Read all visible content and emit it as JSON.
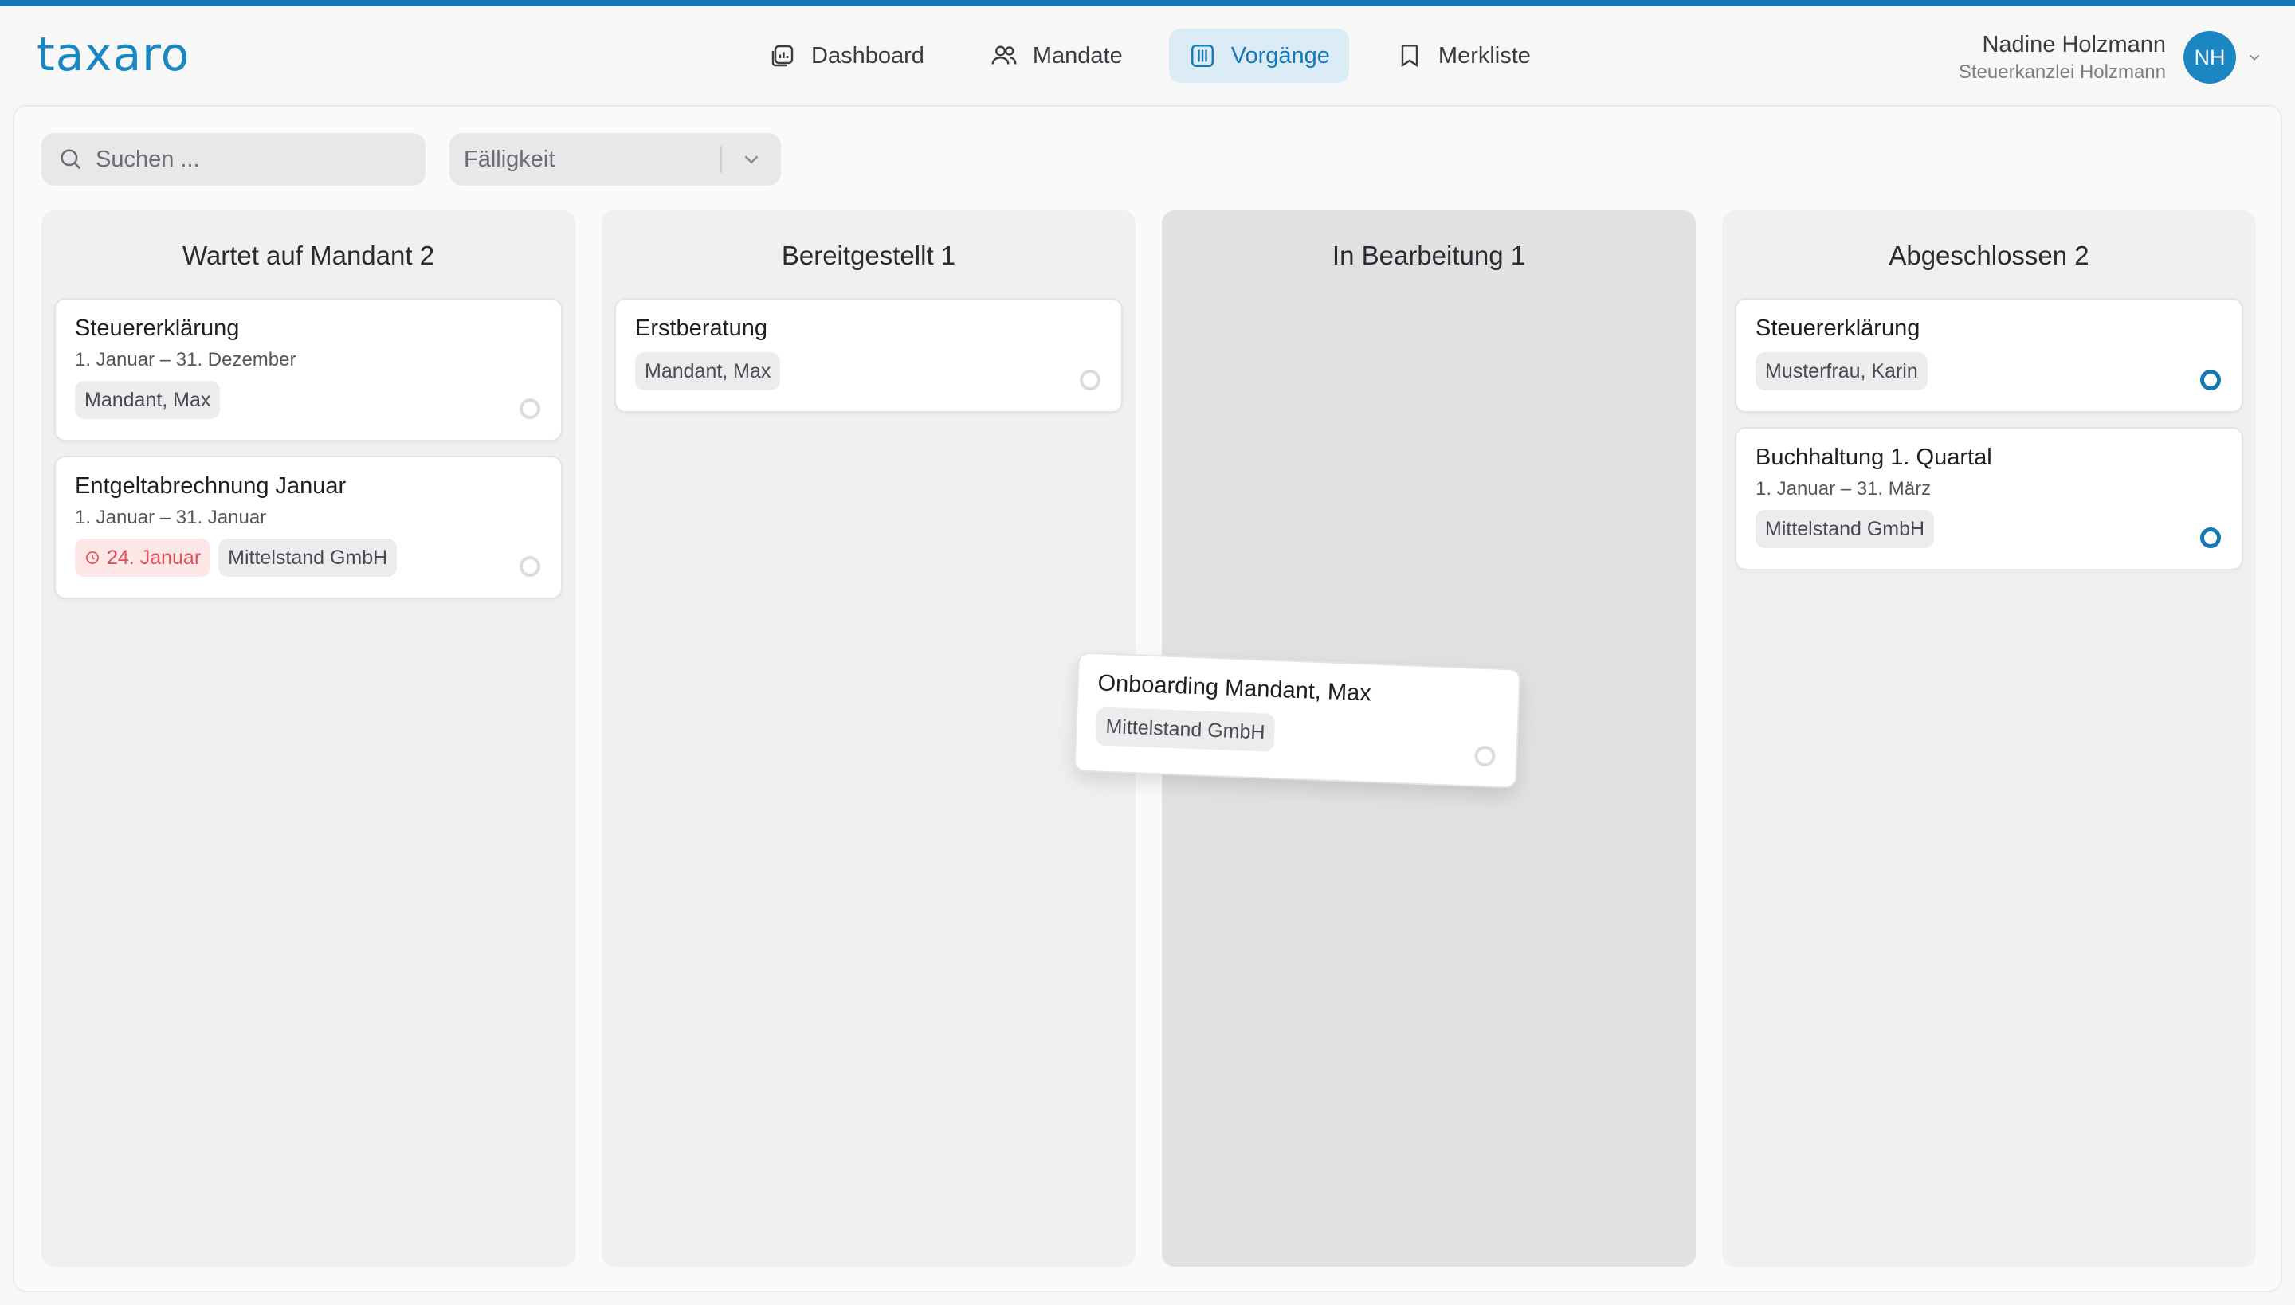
{
  "app": {
    "logo": "taxaro",
    "accent_color": "#1a86c2"
  },
  "nav": [
    {
      "label": "Dashboard",
      "icon": "dashboard-icon",
      "active": false
    },
    {
      "label": "Mandate",
      "icon": "users-icon",
      "active": false
    },
    {
      "label": "Vorgänge",
      "icon": "kanban-icon",
      "active": true
    },
    {
      "label": "Merkliste",
      "icon": "bookmark-icon",
      "active": false
    }
  ],
  "user": {
    "name": "Nadine Holzmann",
    "org": "Steuerkanzlei Holzmann",
    "initials": "NH"
  },
  "toolbar": {
    "search_placeholder": "Suchen ...",
    "filter_value": "Fälligkeit"
  },
  "board": {
    "columns": [
      {
        "title": "Wartet auf Mandant 2",
        "cards": [
          {
            "title": "Steuererklärung",
            "subtitle": "1. Januar – 31. Dezember",
            "tags": [
              "Mandant, Max"
            ],
            "status": "open"
          },
          {
            "title": "Entgeltabrechnung Januar",
            "subtitle": "1. Januar – 31. Januar",
            "due": "24. Januar",
            "tags": [
              "Mittelstand GmbH"
            ],
            "status": "open"
          }
        ]
      },
      {
        "title": "Bereitgestellt 1",
        "cards": [
          {
            "title": "Erstberatung",
            "tags": [
              "Mandant, Max"
            ],
            "status": "open"
          }
        ]
      },
      {
        "title": "In Bearbeitung 1",
        "cards": []
      },
      {
        "title": "Abgeschlossen 2",
        "cards": [
          {
            "title": "Steuererklärung",
            "tags": [
              "Musterfrau, Karin"
            ],
            "status": "done"
          },
          {
            "title": "Buchhaltung 1. Quartal",
            "subtitle": "1. Januar – 31. März",
            "tags": [
              "Mittelstand GmbH"
            ],
            "status": "done"
          }
        ]
      }
    ],
    "dragging_card": {
      "title": "Onboarding Mandant, Max",
      "tags": [
        "Mittelstand GmbH"
      ],
      "status": "open"
    }
  }
}
